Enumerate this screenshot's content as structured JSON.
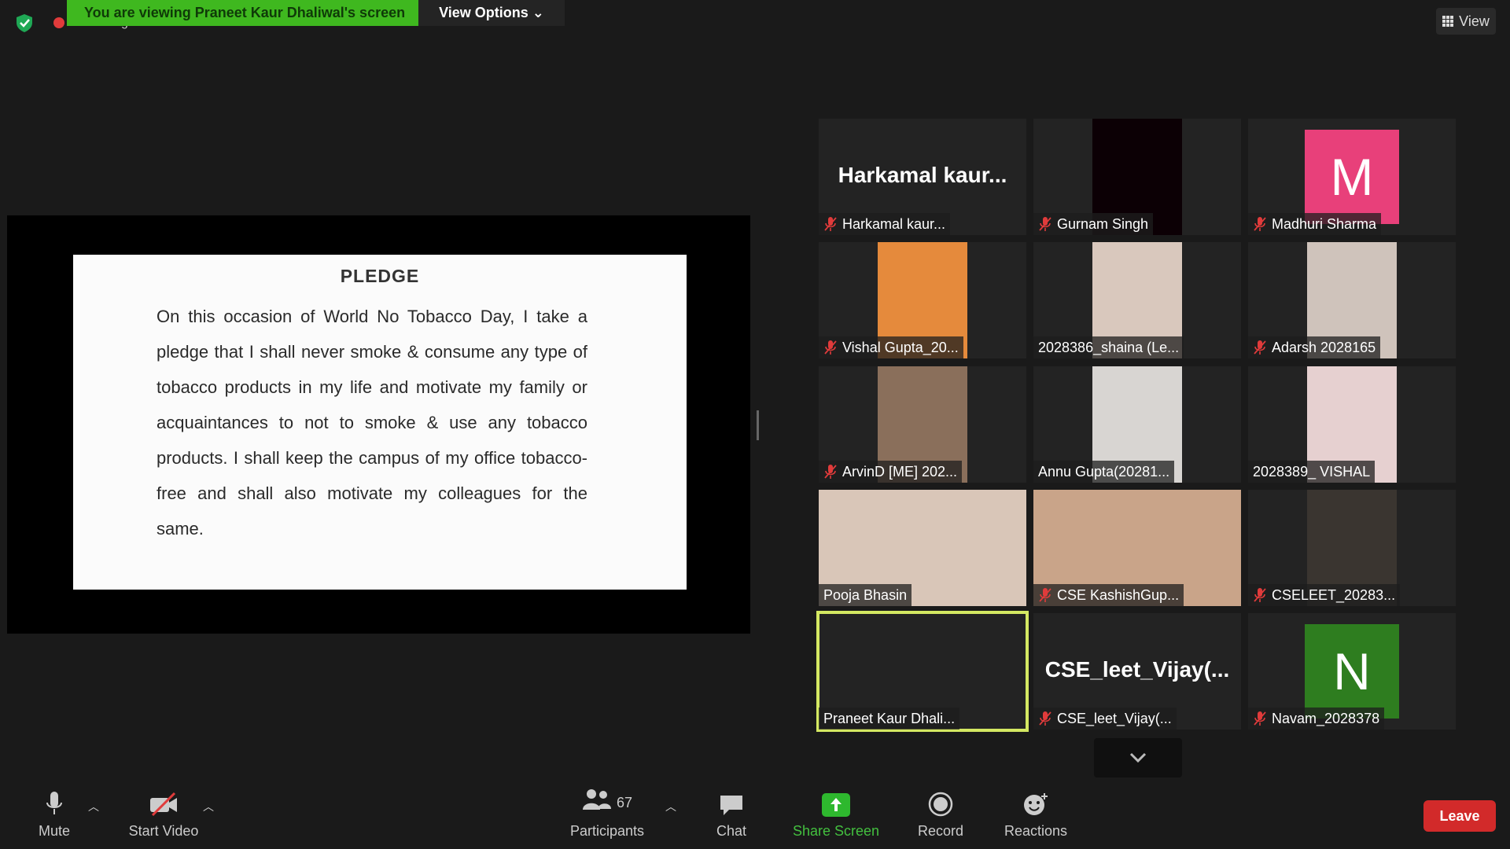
{
  "top": {
    "recording": "Recording",
    "viewing_banner": "You are viewing Praneet Kaur Dhaliwal's screen",
    "view_options": "View Options",
    "view": "View"
  },
  "shared": {
    "title": "PLEDGE",
    "text": "On this occasion of World No Tobacco Day, I take a pledge that I shall never smoke & consume any type of tobacco products in my life and motivate my family or acquaintances to not to smoke & use any tobacco products. I shall keep the campus of my office tobacco-free and shall also motivate my colleagues for the same."
  },
  "participants": [
    {
      "name": "Harkamal  kaur...",
      "big": "Harkamal  kaur...",
      "muted": true
    },
    {
      "name": "Gurnam Singh",
      "muted": true
    },
    {
      "name": "Madhuri Sharma",
      "letter": "M",
      "color": "#e8407a",
      "muted": true
    },
    {
      "name": "Vishal Gupta_20...",
      "muted": true
    },
    {
      "name": "2028386_shaina (Le...",
      "muted": false
    },
    {
      "name": "Adarsh 2028165",
      "muted": true
    },
    {
      "name": "ArvinD [ME] 202...",
      "muted": true
    },
    {
      "name": "Annu Gupta(20281...",
      "muted": false
    },
    {
      "name": "2028389_ VISHAL",
      "muted": false
    },
    {
      "name": "Pooja Bhasin",
      "muted": false
    },
    {
      "name": "CSE KashishGup...",
      "muted": true
    },
    {
      "name": "CSELEET_20283...",
      "muted": true
    },
    {
      "name": "Praneet Kaur Dhali...",
      "muted": false,
      "active": true
    },
    {
      "name": "CSE_leet_Vijay(...",
      "big": "CSE_leet_Vijay(...",
      "muted": true
    },
    {
      "name": "Navam_2028378",
      "letter": "N",
      "color": "#2e7d1f",
      "muted": true
    }
  ],
  "toolbar": {
    "mute": "Mute",
    "start_video": "Start Video",
    "participants": "Participants",
    "participants_count": "67",
    "chat": "Chat",
    "share_screen": "Share Screen",
    "record": "Record",
    "reactions": "Reactions",
    "leave": "Leave"
  }
}
